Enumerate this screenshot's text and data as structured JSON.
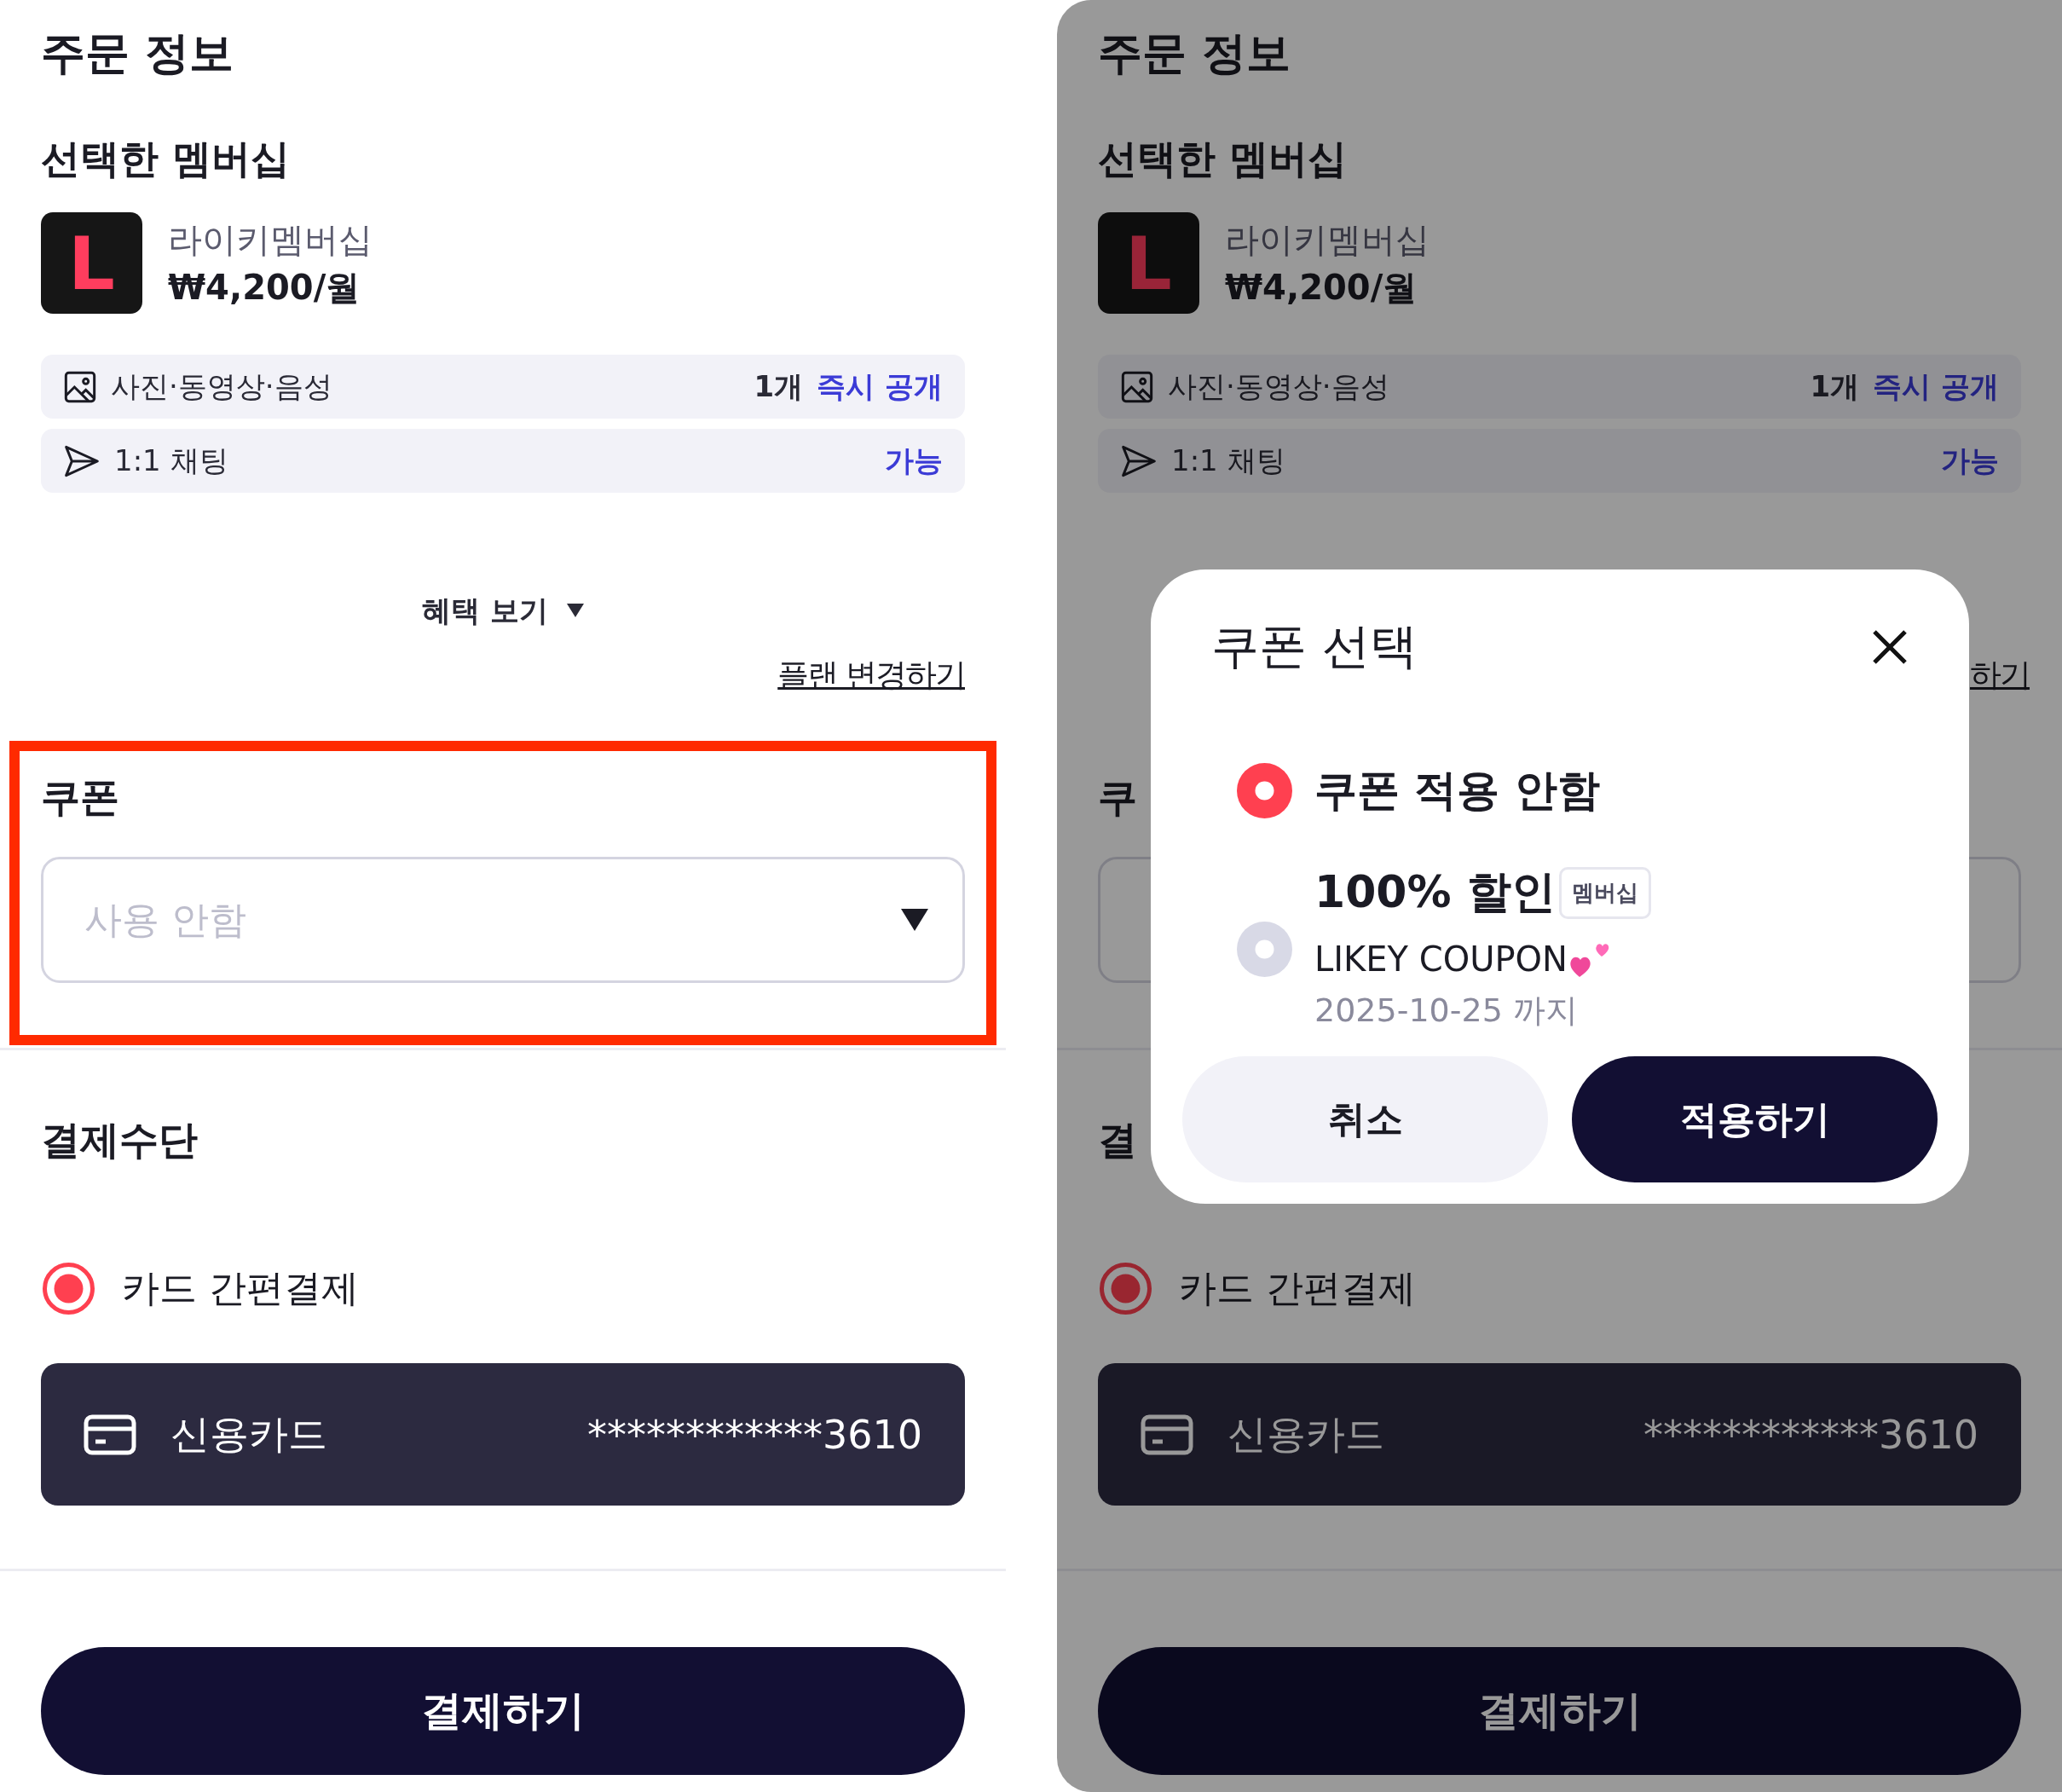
{
  "screens": [
    {
      "dimmed": false,
      "title": "주문 정보",
      "membership_heading": "선택한 멤버십",
      "membership": {
        "logo_letter": "L",
        "name": "라이키멤버십",
        "price": "₩4,200/월"
      },
      "benefits": [
        {
          "kind": "media",
          "label": "사진·동영상·음성",
          "count": "1개",
          "value": "즉시 공개"
        },
        {
          "kind": "chat",
          "label": "1:1 채팅",
          "value": "가능"
        }
      ],
      "benefits_toggle": "혜택 보기",
      "change_plan_link": "플랜 변경하기",
      "coupon": {
        "highlighted": true,
        "heading": "쿠폰",
        "placeholder": "사용 안함"
      },
      "payment": {
        "heading": "결제수단",
        "method": {
          "label": "카드 간편결제",
          "selected": true
        },
        "card": {
          "type": "신용카드",
          "number": "************3610"
        }
      },
      "pay_button": "결제하기"
    },
    {
      "dimmed": true,
      "title": "주문 정보",
      "membership_heading": "선택한 멤버십",
      "membership": {
        "logo_letter": "L",
        "name": "라이키멤버십",
        "price": "₩4,200/월"
      },
      "benefits": [
        {
          "kind": "media",
          "label": "사진·동영상·음성",
          "count": "1개",
          "value": "즉시 공개"
        },
        {
          "kind": "chat",
          "label": "1:1 채팅",
          "value": "가능"
        }
      ],
      "change_plan_link": "하기",
      "coupon": {
        "highlighted": false,
        "heading": "쿠"
      },
      "payment": {
        "heading": "결",
        "method": {
          "label": "카드 간편결제",
          "selected": true
        },
        "card": {
          "type": "신용카드",
          "number": "************3610"
        }
      },
      "pay_button": "결제하기"
    }
  ],
  "coupon_dialog": {
    "title": "쿠폰 선택",
    "options": [
      {
        "kind": "none",
        "label": "쿠폰 적용 안함",
        "selected": true
      },
      {
        "kind": "coupon",
        "title": "100% 할인",
        "tag": "멤버십",
        "name": "LIKEY COUPON",
        "expiry": "2025-10-25 까지",
        "selected": false
      }
    ],
    "buttons": [
      {
        "kind": "cancel",
        "label": "취소"
      },
      {
        "kind": "apply",
        "label": "적용하기"
      }
    ]
  }
}
